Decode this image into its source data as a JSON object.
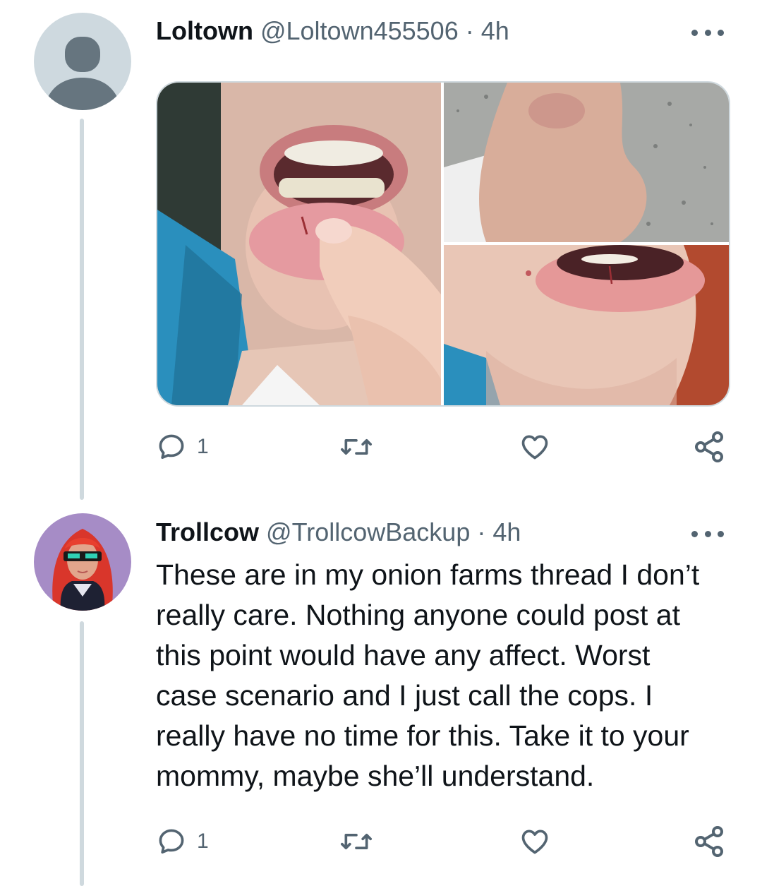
{
  "tweets": [
    {
      "display_name": "Loltown",
      "handle": "@Loltown455506",
      "separator": "·",
      "time": "4h",
      "avatar": "default-avatar",
      "media": [
        {
          "description_icon": "photo-lip-cut-open-mouth"
        },
        {
          "description_icon": "photo-arm-bruise"
        },
        {
          "description_icon": "photo-lip-cut-closeup"
        }
      ],
      "reply_count": "1"
    },
    {
      "display_name": "Trollcow",
      "handle": "@TrollcowBackup",
      "separator": "·",
      "time": "4h",
      "avatar": "red-hair-sunglasses-avatar",
      "text": "These are in my onion farms thread I don’t\nreally care. Nothing anyone could post at\nthis point would have any affect. Worst\ncase scenario and I just call the cops. I\nreally have no time for this. Take it to your\nmommy, maybe she’ll understand.",
      "reply_count": "1"
    }
  ],
  "colors": {
    "text": "#0f1419",
    "secondary": "#536471",
    "border": "#cfd9de",
    "avatar_bg": "#ced9df"
  }
}
